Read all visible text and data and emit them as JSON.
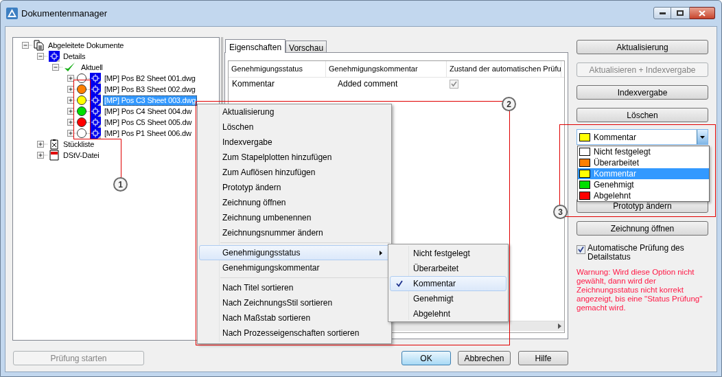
{
  "window": {
    "title": "Dokumentenmanager"
  },
  "tree": {
    "items": [
      {
        "label": "Abgeleitete Dokumente",
        "kind": "root",
        "expanded": true,
        "selected": false,
        "children": [
          {
            "label": "Details",
            "kind": "folder",
            "expanded": true,
            "selected": false,
            "children": [
              {
                "label": "Aktuell",
                "kind": "check",
                "expanded": true,
                "selected": false,
                "children": [
                  {
                    "label": "[MP] Pos B2 Sheet 001.dwg",
                    "kind": "drawing",
                    "expanded": false,
                    "selected": false,
                    "color": "#ffffff"
                  },
                  {
                    "label": "[MP] Pos B3 Sheet 002.dwg",
                    "kind": "drawing",
                    "expanded": false,
                    "selected": false,
                    "color": "#ff8000"
                  },
                  {
                    "label": "[MP] Pos C3 Sheet 003.dwg",
                    "kind": "drawing",
                    "expanded": false,
                    "selected": true,
                    "color": "#ffff00"
                  },
                  {
                    "label": "[MP] Pos C4 Sheet 004.dw",
                    "kind": "drawing",
                    "expanded": false,
                    "selected": false,
                    "color": "#00e000"
                  },
                  {
                    "label": "[MP] Pos C5 Sheet 005.dw",
                    "kind": "drawing",
                    "expanded": false,
                    "selected": false,
                    "color": "#ff0000"
                  },
                  {
                    "label": "[MP] Pos P1 Sheet 006.dw",
                    "kind": "drawing",
                    "expanded": false,
                    "selected": false,
                    "color": "#ffffff"
                  }
                ]
              }
            ]
          },
          {
            "label": "Stückliste",
            "kind": "list",
            "expanded": false,
            "selected": false
          },
          {
            "label": "DStV-Datei",
            "kind": "dstv",
            "expanded": false,
            "selected": false
          }
        ]
      }
    ]
  },
  "tabs": [
    {
      "label": "Eigenschaften",
      "selected": true
    },
    {
      "label": "Vorschau",
      "selected": false
    }
  ],
  "grid": {
    "columns": [
      "Genehmigungsstatus",
      "Genehmigungskommentar",
      "Zustand der automatischen Prüfu"
    ],
    "rows": [
      {
        "status": "Kommentar",
        "comment": "Added comment",
        "checked": true
      }
    ]
  },
  "buttons": [
    {
      "label": "Aktualisierung",
      "disabled": false
    },
    {
      "label": "Aktualisieren + Indexvergabe",
      "disabled": true
    },
    {
      "label": "Indexvergabe",
      "disabled": false
    },
    {
      "label": "Löschen",
      "disabled": false
    }
  ],
  "status_combo": {
    "value": "Kommentar",
    "color": "#ffff00",
    "options": [
      {
        "label": "Nicht festgelegt",
        "color": "#ffffff",
        "selected": false
      },
      {
        "label": "Überarbeitet",
        "color": "#ff8000",
        "selected": false
      },
      {
        "label": "Kommentar",
        "color": "#ffff00",
        "selected": true
      },
      {
        "label": "Genehmigt",
        "color": "#00e000",
        "selected": false
      },
      {
        "label": "Abgelehnt",
        "color": "#ff0000",
        "selected": false
      }
    ]
  },
  "lower_buttons": [
    {
      "label": "Prototyp ändern",
      "disabled": false
    },
    {
      "label": "Zeichnung öffnen",
      "disabled": false
    }
  ],
  "auto_check": {
    "label": "Automatische Prüfung des Detailstatus",
    "checked": true
  },
  "warning": "Warnung: Wird diese Option nicht gewählt, dann wird der Zeichnungsstatus nicht korrekt angezeigt, bis eine \"Status Prüfung\" gemacht wird.",
  "context_menu": {
    "groups": [
      {
        "items": [
          {
            "label": "Aktualisierung",
            "kind": "item",
            "selected": false
          },
          {
            "label": "Löschen",
            "kind": "item",
            "selected": false
          },
          {
            "label": "Indexvergabe",
            "kind": "item",
            "selected": false
          },
          {
            "label": "Zum Stapelplotten hinzufügen",
            "kind": "item",
            "selected": false
          },
          {
            "label": "Zum Auflösen hinzufügen",
            "kind": "item",
            "selected": false
          },
          {
            "label": "Prototyp ändern",
            "kind": "item",
            "selected": false
          },
          {
            "label": "Zeichnung öffnen",
            "kind": "item",
            "selected": false
          },
          {
            "label": "Zeichnung umbenennen",
            "kind": "item",
            "selected": false
          },
          {
            "label": "Zeichnungsnummer ändern",
            "kind": "item",
            "selected": false
          }
        ]
      },
      {
        "items": [
          {
            "label": "Genehmigungsstatus",
            "kind": "submenu",
            "selected": true
          },
          {
            "label": "Genehmigungskommentar",
            "kind": "item",
            "selected": false
          }
        ]
      },
      {
        "items": [
          {
            "label": "Nach Titel sortieren",
            "kind": "item",
            "selected": false
          },
          {
            "label": "Nach ZeichnungsStil sortieren",
            "kind": "item",
            "selected": false
          },
          {
            "label": "Nach Maßstab sortieren",
            "kind": "item",
            "selected": false
          },
          {
            "label": "Nach Prozesseigenschaften sortieren",
            "kind": "item",
            "selected": false
          }
        ]
      }
    ]
  },
  "submenu": {
    "items": [
      {
        "label": "Nicht festgelegt",
        "selected": false
      },
      {
        "label": "Überarbeitet",
        "selected": false
      },
      {
        "label": "Kommentar",
        "selected": true
      },
      {
        "label": "Genehmigt",
        "selected": false
      },
      {
        "label": "Abgelehnt",
        "selected": false
      }
    ]
  },
  "footer": {
    "start_button": {
      "label": "Prüfung starten",
      "disabled": true
    },
    "buttons": [
      {
        "label": "OK",
        "default": true
      },
      {
        "label": "Abbrechen",
        "default": false
      },
      {
        "label": "Hilfe",
        "default": false
      }
    ]
  },
  "callouts": [
    "1",
    "2",
    "3"
  ]
}
